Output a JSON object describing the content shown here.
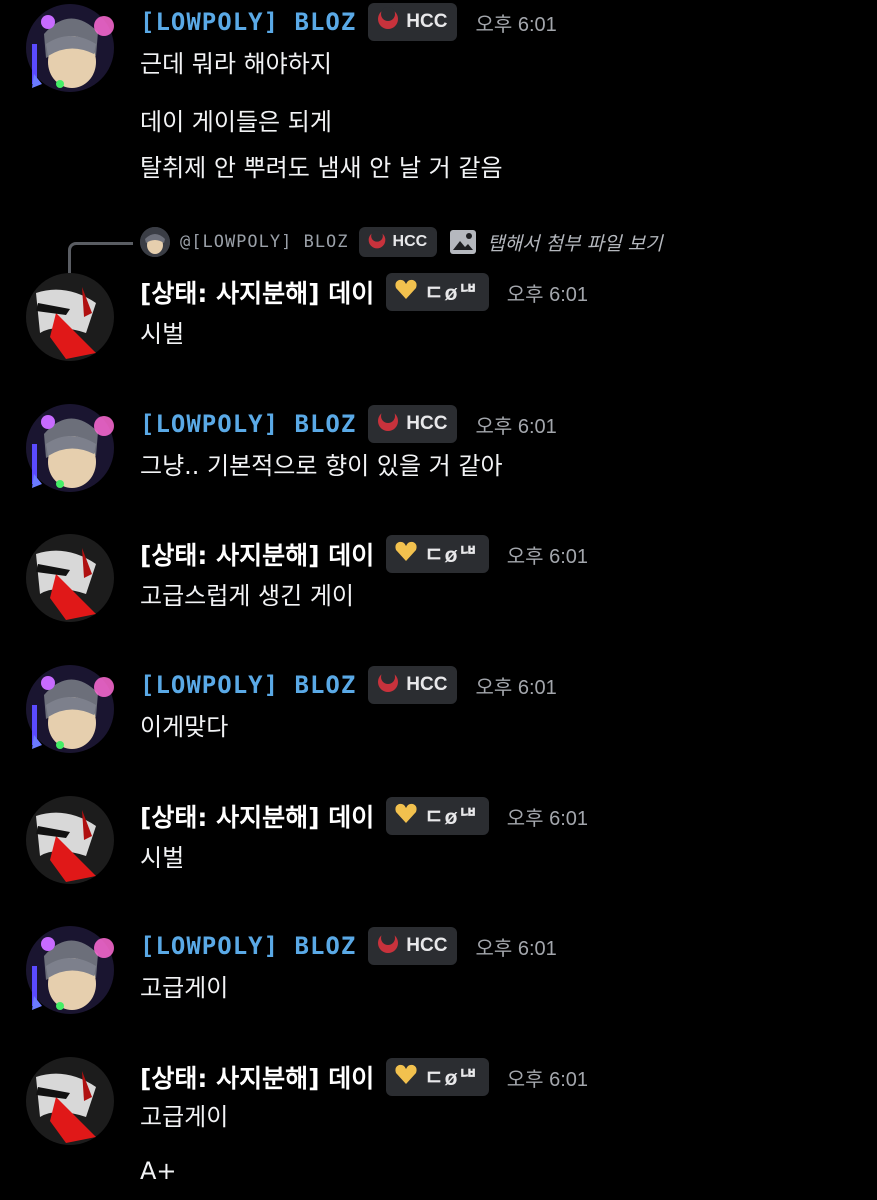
{
  "users": {
    "bloz": {
      "name": "[LOWPOLY] BLOZ",
      "tag": "HCC"
    },
    "dei": {
      "name": "[상태: 사지분해] 데이",
      "tag": "ㄷøᄖ"
    }
  },
  "reply": {
    "name": "@[LOWPOLY] BLOZ",
    "tag": "HCC",
    "attachment_text": "탭해서 첨부 파일 보기"
  },
  "messages": [
    {
      "author": "[LOWPOLY] BLOZ",
      "tag": "HCC",
      "time": "오후 6:01",
      "lines": [
        "근데 뭐라 해야하지",
        "데이 게이들은 되게",
        "탈취제 안 뿌려도 냄새 안 날 거 같음"
      ]
    },
    {
      "author": "[상태: 사지분해] 데이",
      "tag": "ㄷøᄖ",
      "time": "오후 6:01",
      "lines": [
        "시벌"
      ]
    },
    {
      "author": "[LOWPOLY] BLOZ",
      "tag": "HCC",
      "time": "오후 6:01",
      "lines": [
        "그냥.. 기본적으로 향이 있을 거 같아"
      ]
    },
    {
      "author": "[상태: 사지분해] 데이",
      "tag": "ㄷøᄖ",
      "time": "오후 6:01",
      "lines": [
        "고급스럽게 생긴 게이"
      ]
    },
    {
      "author": "[LOWPOLY] BLOZ",
      "tag": "HCC",
      "time": "오후 6:01",
      "lines": [
        "이게맞다"
      ]
    },
    {
      "author": "[상태: 사지분해] 데이",
      "tag": "ㄷøᄖ",
      "time": "오후 6:01",
      "lines": [
        "시벌"
      ]
    },
    {
      "author": "[LOWPOLY] BLOZ",
      "tag": "HCC",
      "time": "오후 6:01",
      "lines": [
        "고급게이"
      ]
    },
    {
      "author": "[상태: 사지분해] 데이",
      "tag": "ㄷøᄖ",
      "time": "오후 6:01",
      "lines": [
        "고급게이",
        "A+"
      ]
    }
  ],
  "colors": {
    "background": "#000000",
    "bloz_name": "#5aa9e6",
    "tag_bg": "#2b2d31",
    "timestamp": "#a3a6ac"
  },
  "icons": {
    "bloz_tag": "red-crescent-icon",
    "dei_tag": "gold-heart-icon",
    "attachment": "image-icon"
  }
}
